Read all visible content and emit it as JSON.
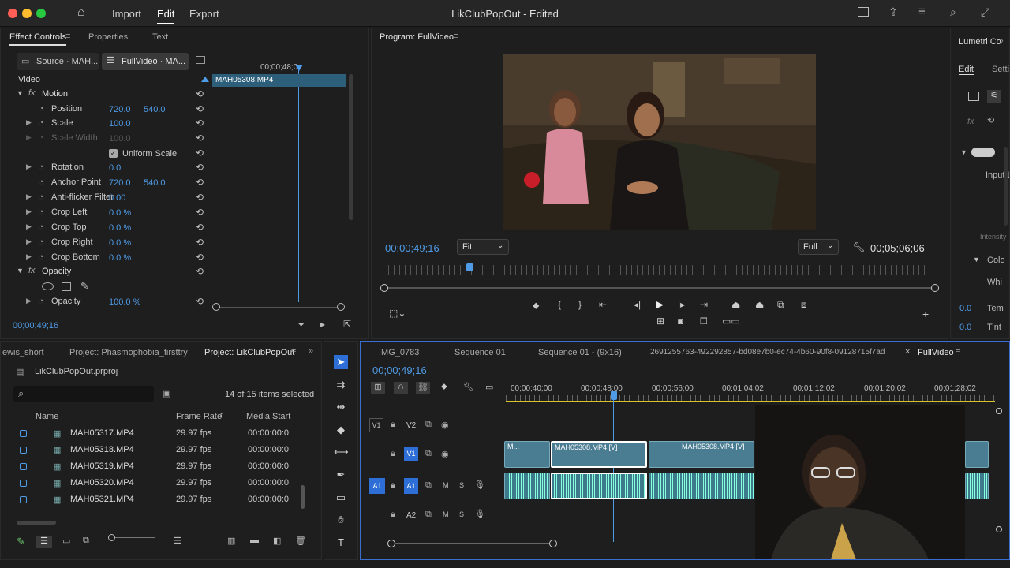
{
  "app": {
    "title": "LikClubPopOut - Edited"
  },
  "menu": {
    "import": "Import",
    "edit": "Edit",
    "export": "Export"
  },
  "effect_panel": {
    "tabs": {
      "effect_controls": "Effect Controls",
      "properties": "Properties",
      "text": "Text"
    },
    "source_tab": "Source · MAH...",
    "seq_tab": "FullVideo · MA...",
    "timecode_top": "00;00;48;0",
    "clip_name": "MAH05308.MP4",
    "video_label": "Video",
    "rows": {
      "motion": "Motion",
      "position": {
        "label": "Position",
        "v1": "720.0",
        "v2": "540.0"
      },
      "scale": {
        "label": "Scale",
        "v1": "100.0"
      },
      "scale_width": {
        "label": "Scale Width",
        "v1": "100.0"
      },
      "uniform_scale": "Uniform Scale",
      "rotation": {
        "label": "Rotation",
        "v1": "0.0"
      },
      "anchor": {
        "label": "Anchor Point",
        "v1": "720.0",
        "v2": "540.0"
      },
      "anti_flicker": {
        "label": "Anti-flicker Filter",
        "v1": "0.00"
      },
      "crop_left": {
        "label": "Crop Left",
        "v1": "0.0 %"
      },
      "crop_top": {
        "label": "Crop Top",
        "v1": "0.0 %"
      },
      "crop_right": {
        "label": "Crop Right",
        "v1": "0.0 %"
      },
      "crop_bottom": {
        "label": "Crop Bottom",
        "v1": "0.0 %"
      },
      "opacity_section": "Opacity",
      "opacity": {
        "label": "Opacity",
        "v1": "100.0 %"
      }
    },
    "bottom_timecode": "00;00;49;16"
  },
  "program": {
    "title": "Program: FullVideo",
    "timecode": "00;00;49;16",
    "fit": "Fit",
    "full": "Full",
    "duration": "00;05;06;06"
  },
  "lumetri": {
    "title": "Lumetri Co",
    "edit": "Edit",
    "settings": "Settin",
    "input": "Input LU",
    "intensity": "Intensity",
    "color": "Colo",
    "white": "Whi",
    "temp_val": "0.0",
    "temp": "Tem",
    "tint_val": "0.0",
    "tint": "Tint"
  },
  "project": {
    "tabs": {
      "first": "ewis_short",
      "second": "Project: Phasmophobia_firsttry",
      "third": "Project: LikClubPopOut"
    },
    "file": "LikClubPopOut.prproj",
    "selected": "14 of 15 items selected",
    "columns": {
      "name": "Name",
      "rate": "Frame Rate",
      "start": "Media Start"
    },
    "items": [
      {
        "name": "MAH05317.MP4",
        "rate": "29.97 fps",
        "start": "00:00:00:0"
      },
      {
        "name": "MAH05318.MP4",
        "rate": "29.97 fps",
        "start": "00:00:00:0"
      },
      {
        "name": "MAH05319.MP4",
        "rate": "29.97 fps",
        "start": "00:00:00:0"
      },
      {
        "name": "MAH05320.MP4",
        "rate": "29.97 fps",
        "start": "00:00:00:0"
      },
      {
        "name": "MAH05321.MP4",
        "rate": "29.97 fps",
        "start": "00:00:00:0"
      }
    ]
  },
  "timeline": {
    "tabs": {
      "t1": "IMG_0783",
      "t2": "Sequence 01",
      "t3": "Sequence 01 - (9x16)",
      "t4": "2691255763-492292857-bd08e7b0-ec74-4b60-90f8-09128715f7ad",
      "t5": "FullVideo"
    },
    "timecode": "00;00;49;16",
    "ruler": [
      "00;00;40;00",
      "00;00;48;00",
      "00;00;56;00",
      "00;01;04;02",
      "00;01;12;02",
      "00;01;20;02",
      "00;01;28;02"
    ],
    "tracks": {
      "v2": "V2",
      "v1": "V1",
      "a1": "A1",
      "a2": "A2",
      "m": "M",
      "s": "S"
    },
    "clips": {
      "c0": "M...",
      "c1": "MAH05308.MP4 [V]",
      "c2": "MAH05308.MP4 [V]"
    }
  }
}
